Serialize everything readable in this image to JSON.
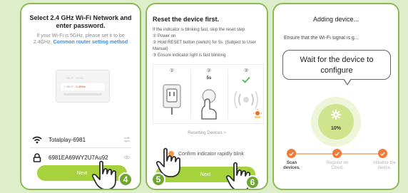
{
  "panel1": {
    "title": "Select 2.4 GHz Wi-Fi Network and enter password.",
    "subtitle_plain": "If your Wi-Fi is 5GHz, please set it to be 2.4GHz.",
    "subtitle_link": "Common router setting method",
    "network_name": "Totalplay-6981",
    "password": "6981EA69WY2U7Au92",
    "next_label": "Next",
    "step_number": "4"
  },
  "panel2": {
    "title": "Reset the device first.",
    "line1": "If the indicator is blinking fast, skip the reset step",
    "line2": "① Power on",
    "line3": "② Hold RESET button (switch) for 5s. (Subject to User Manual)",
    "line4": "③ Ensure indicator light is fast blinking",
    "diagram_step1": "①",
    "diagram_step2": "②",
    "diagram_step3": "③",
    "diagram_seconds": "5s",
    "resetting_link": "Resetting Devices >",
    "confirm_label": "Confirm indicator rapidly blink",
    "next_label": "Next",
    "step_left": "5",
    "step_right": "6"
  },
  "panel3": {
    "title": "Adding device...",
    "subtitle": "Ensure that the Wi-Fi signal is g...",
    "bubble_text": "Wait for the device to configure",
    "progress_text": "10%",
    "progress_value": 10,
    "steps": [
      {
        "label": "Scan devices.",
        "active": true
      },
      {
        "label": "Register on Cloud.",
        "active": false
      },
      {
        "label": "Initialize the device.",
        "active": false
      }
    ]
  },
  "colors": {
    "accent_green": "#a6d33b",
    "step_orange": "#f07a36",
    "border_green": "#8fb856",
    "link_blue": "#3d8ee0"
  }
}
